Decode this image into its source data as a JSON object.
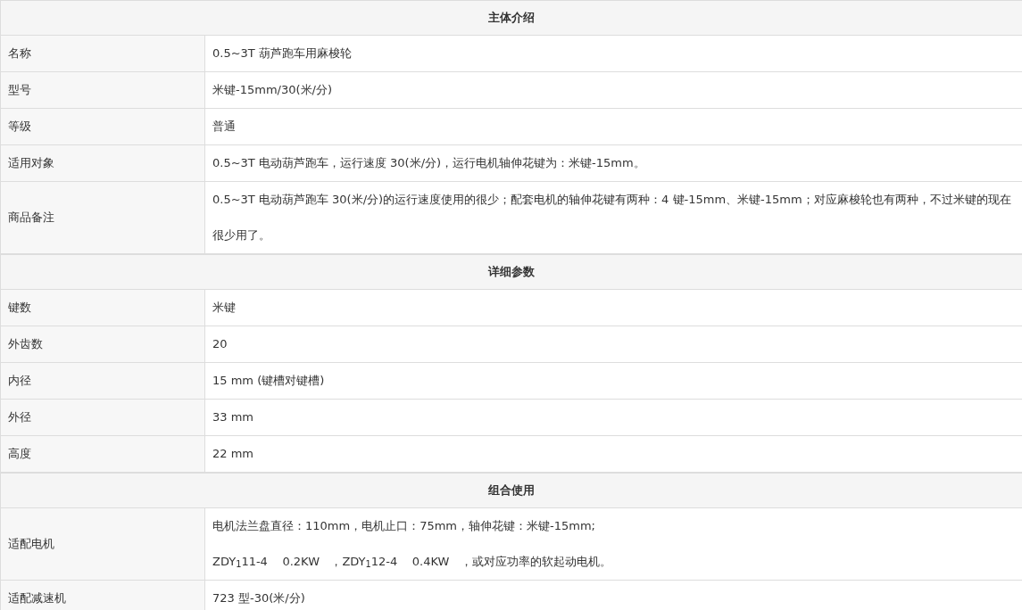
{
  "sections": [
    {
      "title": "主体介绍",
      "rows": [
        {
          "label": "名称",
          "lines": [
            "0.5~3T 葫芦跑车用麻梭轮"
          ]
        },
        {
          "label": "型号",
          "lines": [
            "米键-15mm/30(米/分)"
          ]
        },
        {
          "label": "等级",
          "lines": [
            "普通"
          ]
        },
        {
          "label": "适用对象",
          "lines": [
            "0.5~3T 电动葫芦跑车，运行速度 30(米/分)，运行电机轴伸花键为：米键-15mm。"
          ]
        },
        {
          "label": "商品备注",
          "lines": [
            "0.5~3T 电动葫芦跑车 30(米/分)的运行速度使用的很少；配套电机的轴伸花键有两种：4 键-15mm、米键-15mm；对应麻梭轮也有两种，不过米键的现在很少用了。"
          ]
        }
      ]
    },
    {
      "title": "详细参数",
      "rows": [
        {
          "label": "键数",
          "lines": [
            "米键"
          ]
        },
        {
          "label": "外齿数",
          "lines": [
            "20"
          ]
        },
        {
          "label": "内径",
          "lines": [
            "15 mm (键槽对键槽)"
          ]
        },
        {
          "label": "外径",
          "lines": [
            "33 mm"
          ]
        },
        {
          "label": "高度",
          "lines": [
            "22 mm"
          ]
        }
      ]
    },
    {
      "title": "组合使用",
      "rows": [
        {
          "label": "适配电机",
          "lines": [
            "电机法兰盘直径：110mm，电机止口：75mm，轴伸花键：米键-15mm;",
            "ZDY$_{1}$11-4    0.2KW   ，ZDY$_{1}$12-4    0.4KW   ，或对应功率的软起动电机。"
          ]
        },
        {
          "label": "适配减速机",
          "lines": [
            "723 型-30(米/分)"
          ]
        }
      ]
    }
  ]
}
